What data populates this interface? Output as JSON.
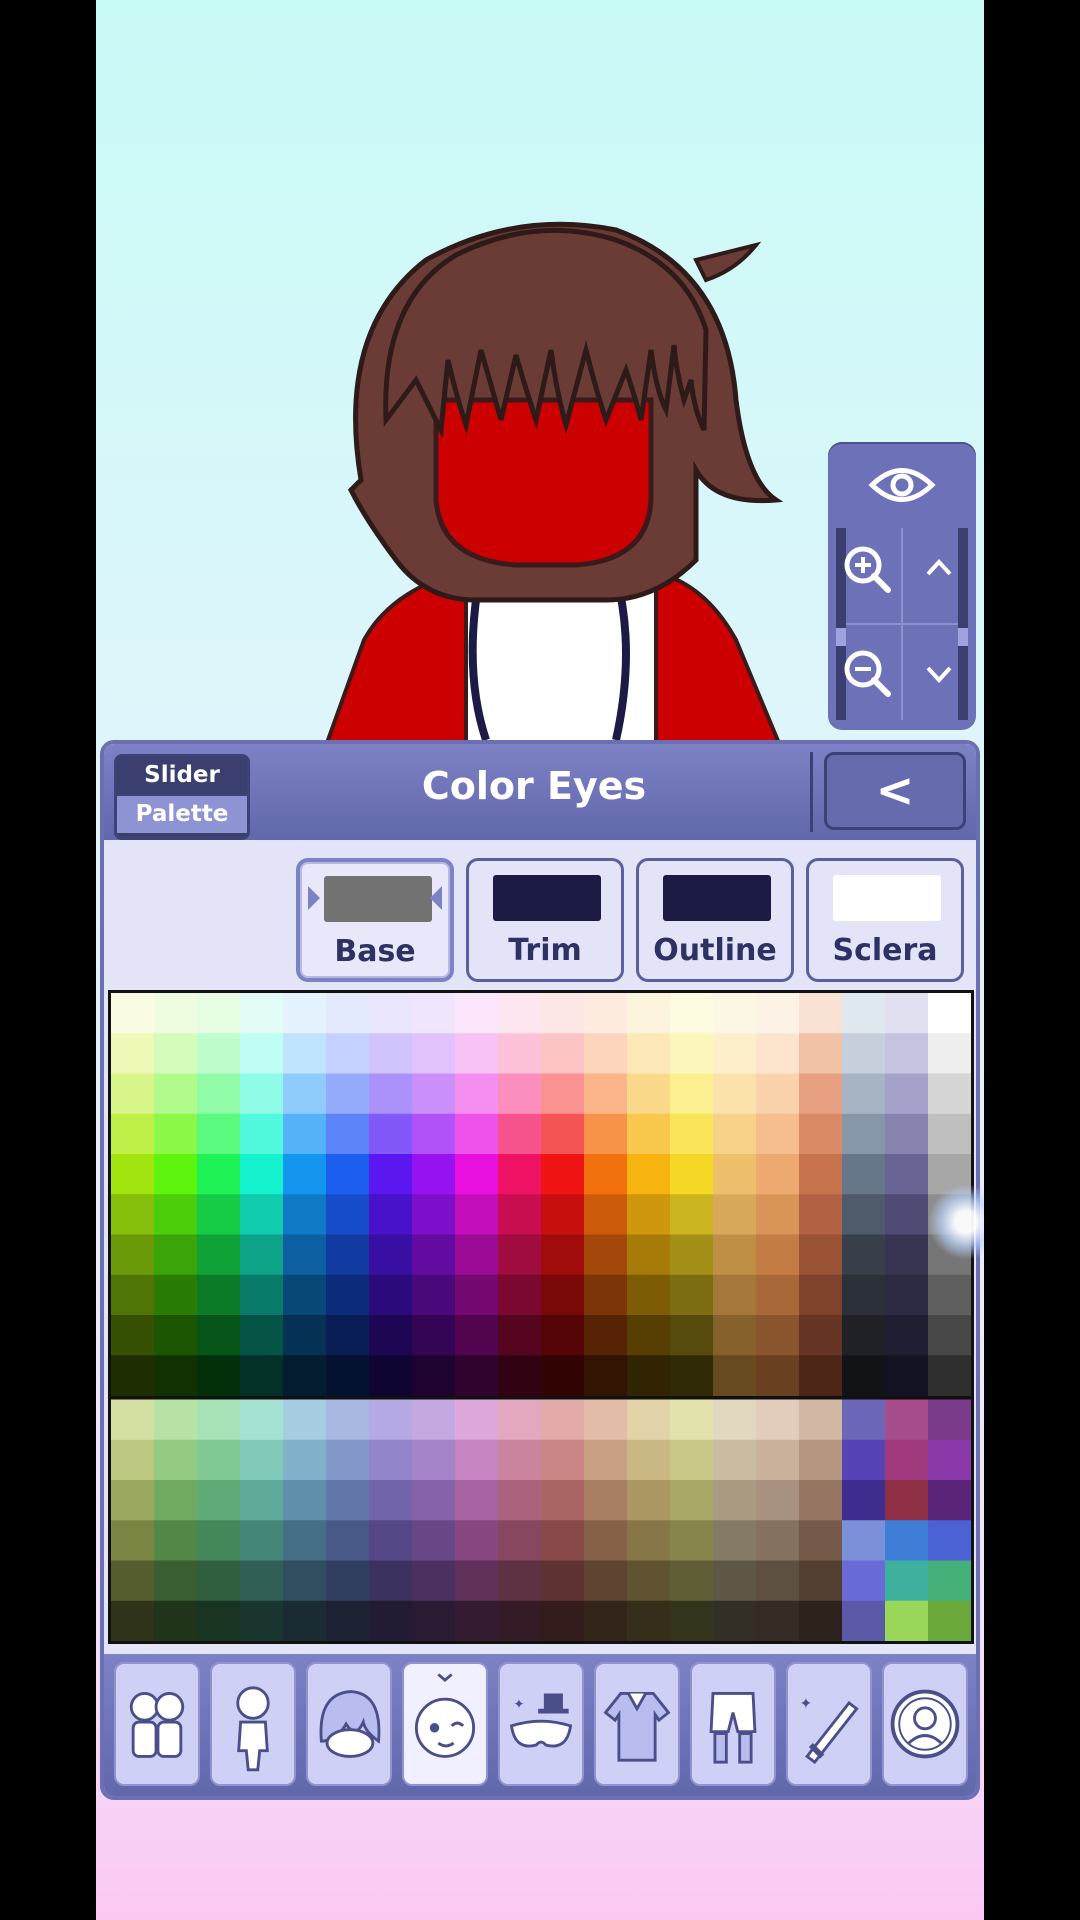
{
  "panel": {
    "title": "Color Eyes",
    "mode_options": [
      "Slider",
      "Palette"
    ],
    "mode_selected": "Palette",
    "back_label": "<"
  },
  "swatch_tabs": [
    {
      "label": "Base",
      "color": "#727272",
      "selected": true
    },
    {
      "label": "Trim",
      "color": "#1b1b45",
      "selected": false
    },
    {
      "label": "Outline",
      "color": "#1b1b45",
      "selected": false
    },
    {
      "label": "Sclera",
      "color": "#ffffff",
      "selected": false
    }
  ],
  "view_controls": {
    "icons": [
      "eye-icon",
      "zoom-in-icon",
      "zoom-out-icon",
      "chevron-up-icon",
      "chevron-down-icon"
    ]
  },
  "categories": [
    {
      "name": "presets",
      "icon": "characters-icon",
      "selected": false
    },
    {
      "name": "body",
      "icon": "body-icon",
      "selected": false
    },
    {
      "name": "hair",
      "icon": "hair-icon",
      "selected": false
    },
    {
      "name": "face",
      "icon": "face-icon",
      "selected": true
    },
    {
      "name": "accessories",
      "icon": "hat-mask-icon",
      "selected": false
    },
    {
      "name": "top",
      "icon": "shirt-icon",
      "selected": false
    },
    {
      "name": "bottom",
      "icon": "pants-icon",
      "selected": false
    },
    {
      "name": "props",
      "icon": "sword-icon",
      "selected": false
    },
    {
      "name": "profile",
      "icon": "profile-icon",
      "selected": false
    }
  ],
  "palette_rows": [
    [
      "#f9fbe2",
      "#eefce0",
      "#e6fde4",
      "#e2fdf6",
      "#e4f3fd",
      "#e4eafd",
      "#e9e6fd",
      "#f0e6fd",
      "#fbe6fb",
      "#fde6ef",
      "#fde6e6",
      "#fdebe0",
      "#fdf4de",
      "#fdfbe0",
      "#fdf8e6",
      "#fdf2e6",
      "#f9e2d4",
      "#dfe7ef",
      "#e0e0f0",
      "#ffffff"
    ],
    [
      "#eef9b8",
      "#d6fcbc",
      "#c0fdcc",
      "#c0fdf4",
      "#c0e4fd",
      "#c4d0fd",
      "#d1c4fd",
      "#e2c2fd",
      "#f8c2f5",
      "#fcc2da",
      "#fcc4c4",
      "#fdd4bc",
      "#fde9b8",
      "#fdf6bc",
      "#fdefcc",
      "#fde4cc",
      "#f2c2a6",
      "#c5d0dc",
      "#c4c4e0",
      "#eeeeee"
    ],
    [
      "#d9f68a",
      "#b0fb8c",
      "#91fca7",
      "#8ffce7",
      "#8fcbfb",
      "#94acfb",
      "#ab92fb",
      "#cb8ffb",
      "#f48ff0",
      "#fa8fbd",
      "#fa9292",
      "#fbb58a",
      "#fbd98a",
      "#fbef90",
      "#fbe2ac",
      "#fad2ac",
      "#e7a182",
      "#a7b4c4",
      "#a5a2c9",
      "#d6d6d6"
    ],
    [
      "#bff04a",
      "#8cf949",
      "#5afa7e",
      "#52fadd",
      "#55b1f8",
      "#5c84f8",
      "#8358f8",
      "#b152f8",
      "#ef52e9",
      "#f5528e",
      "#f55454",
      "#f7924a",
      "#f9c74c",
      "#fae45a",
      "#f9d28a",
      "#f6bd8e",
      "#d98a66",
      "#8796a8",
      "#8783ae",
      "#bfbfbf"
    ],
    [
      "#a2e40f",
      "#5ef40e",
      "#1ef256",
      "#14f2ce",
      "#1496ef",
      "#1b5ef0",
      "#5a17f0",
      "#9712f0",
      "#e911e0",
      "#ef1163",
      "#ef1313",
      "#f2710f",
      "#f7b410",
      "#f5d825",
      "#efc06c",
      "#ecaa70",
      "#c7734e",
      "#677689",
      "#686494",
      "#a6a6a6"
    ],
    [
      "#87c00c",
      "#4bcd0b",
      "#16cb46",
      "#10cbac",
      "#1079c8",
      "#164cca",
      "#4812ca",
      "#7d0ec9",
      "#c30ebc",
      "#c80e51",
      "#c80f0f",
      "#cb5b0b",
      "#cf970b",
      "#cbb41e",
      "#d8a95a",
      "#d99458",
      "#b26242",
      "#4f5b6a",
      "#4f4b74",
      "#8e8e8e"
    ],
    [
      "#6a9a09",
      "#3aa408",
      "#10a236",
      "#0ca389",
      "#0c5fa0",
      "#113ba2",
      "#390ea2",
      "#630ba1",
      "#9b0b96",
      "#a00b40",
      "#a00b0b",
      "#a4470a",
      "#a77b09",
      "#a38f18",
      "#c08f46",
      "#c47c45",
      "#9a5235",
      "#383f4b",
      "#383553",
      "#767676"
    ],
    [
      "#507506",
      "#2b7c05",
      "#0b7b28",
      "#087c68",
      "#084879",
      "#0c2c7b",
      "#2b0a7b",
      "#4b087a",
      "#760871",
      "#7a0830",
      "#7a0808",
      "#7c3507",
      "#7e5c06",
      "#7c6c12",
      "#a37839",
      "#a86838",
      "#7f432b",
      "#2c3039",
      "#2d2b44",
      "#5f5f5f"
    ],
    [
      "#375104",
      "#1d5603",
      "#075519",
      "#055547",
      "#053254",
      "#081e55",
      "#1d0755",
      "#340555",
      "#52054e",
      "#550520",
      "#550505",
      "#562404",
      "#573f04",
      "#564a0c",
      "#86612c",
      "#8a542c",
      "#663422",
      "#1f2127",
      "#201e33",
      "#474747"
    ],
    [
      "#1f2e02",
      "#103102",
      "#033009",
      "#033128",
      "#031c30",
      "#041130",
      "#100430",
      "#1e0330",
      "#2f032d",
      "#310312",
      "#310303",
      "#311402",
      "#312402",
      "#312a07",
      "#674a20",
      "#6b4020",
      "#4d2618",
      "#121317",
      "#131222",
      "#2f2f2f"
    ],
    [
      "#d4dfa2",
      "#b6e2a3",
      "#a6e2b6",
      "#a6e2d4",
      "#a6cde2",
      "#a9b8e2",
      "#b4a9e2",
      "#c5a8e2",
      "#dda8d9",
      "#e2a8c0",
      "#e2aaaa",
      "#e2bca8",
      "#e2d2a8",
      "#e2e2ac",
      "#e2d8bf",
      "#e2cdbc",
      "#d3b7a5",
      "#6b66b8",
      "#a64b8c",
      "#7a3b8a"
    ],
    [
      "#bcc881",
      "#94ca82",
      "#81ca95",
      "#81cab9",
      "#81b0ca",
      "#8598ca",
      "#9285ca",
      "#a684ca",
      "#c684c1",
      "#ca84a0",
      "#ca8686",
      "#caa084",
      "#cab884",
      "#cac888",
      "#cabca0",
      "#cab19c",
      "#b69681",
      "#5643b6",
      "#a13a7c",
      "#8a3aa8"
    ],
    [
      "#9aa85f",
      "#6faa60",
      "#5faa76",
      "#5faa99",
      "#5f8faa",
      "#6376aa",
      "#7163aa",
      "#8562aa",
      "#a662a1",
      "#aa627e",
      "#aa6464",
      "#aa7e62",
      "#aa9762",
      "#aaa866",
      "#a89b82",
      "#a8917e",
      "#967663",
      "#3e2c8e",
      "#8f2f46",
      "#5a2478"
    ],
    [
      "#7a8544",
      "#528745",
      "#448759",
      "#448779",
      "#446f87",
      "#485887",
      "#564887",
      "#694787",
      "#874780",
      "#874761",
      "#874949",
      "#876147",
      "#877647",
      "#87854b",
      "#857b64",
      "#857160",
      "#765a49",
      "#7b90d8",
      "#3f7ed6",
      "#4b62d4"
    ],
    [
      "#565e2f",
      "#395f30",
      "#2f5f3e",
      "#2f5f55",
      "#2f4e5f",
      "#323e5f",
      "#3c325f",
      "#4a315f",
      "#5f315a",
      "#5f3144",
      "#5f3333",
      "#5f4431",
      "#5f5331",
      "#5f5e35",
      "#5e5646",
      "#5e4f43",
      "#534033",
      "#6a6ad8",
      "#3fb09e",
      "#46b07a"
    ],
    [
      "#2f331a",
      "#1f341b",
      "#1a3422",
      "#1a342e",
      "#1a2b34",
      "#1c2234",
      "#211c34",
      "#291b34",
      "#341b31",
      "#341b25",
      "#341c1c",
      "#34251b",
      "#342e1b",
      "#34341d",
      "#342f26",
      "#342b25",
      "#2e231c",
      "#5a5aa8",
      "#9ad65a",
      "#6aa83a"
    ]
  ]
}
